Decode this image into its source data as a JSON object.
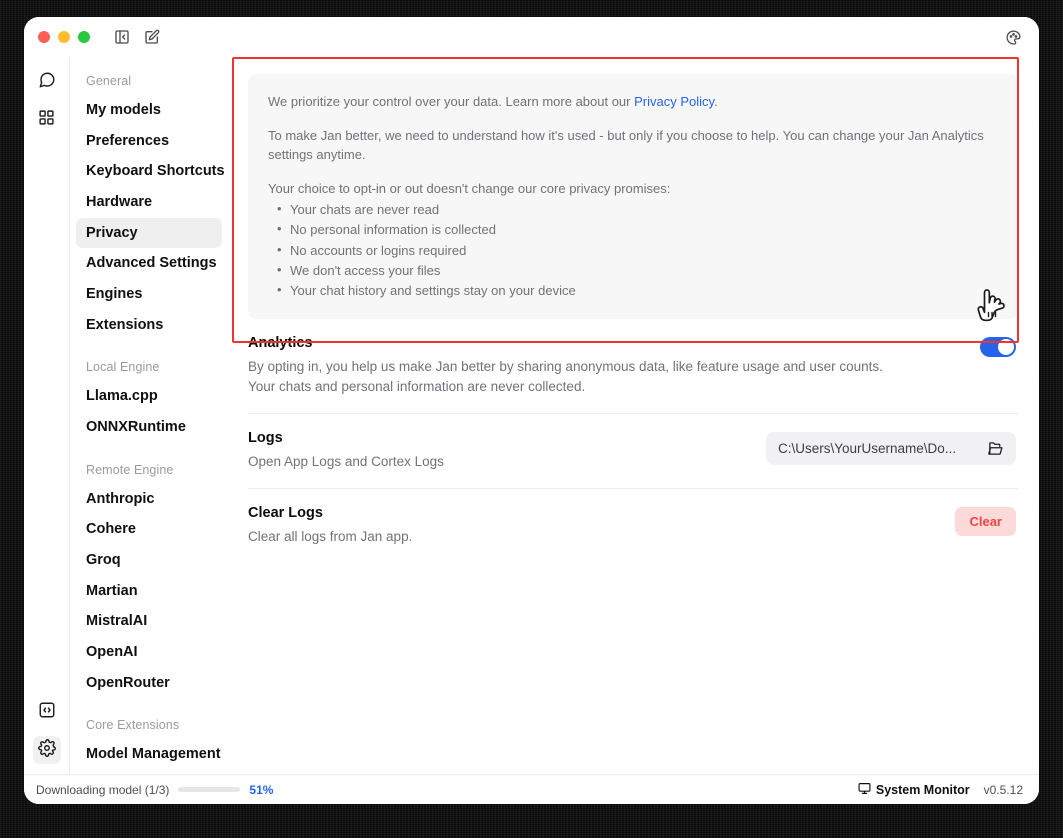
{
  "window": {
    "titlebar": {
      "traffic_lights": [
        "close",
        "minimize",
        "maximize"
      ],
      "toggle_sidebar_label": "Toggle sidebar",
      "new_chat_label": "New chat",
      "theme_label": "Appearance"
    }
  },
  "rail": {
    "items": [
      {
        "name": "chat",
        "icon": "chat-bubble-icon",
        "active": false
      },
      {
        "name": "hub",
        "icon": "grid-apps-icon",
        "active": false
      }
    ],
    "bottom_items": [
      {
        "name": "developer",
        "icon": "code-brackets-icon",
        "active": false
      },
      {
        "name": "settings",
        "icon": "gear-icon",
        "active": true
      }
    ]
  },
  "sidebar": {
    "groups": [
      {
        "label": "General",
        "items": [
          {
            "label": "My models",
            "selected": false
          },
          {
            "label": "Preferences",
            "selected": false
          },
          {
            "label": "Keyboard Shortcuts",
            "selected": false
          },
          {
            "label": "Hardware",
            "selected": false
          },
          {
            "label": "Privacy",
            "selected": true
          },
          {
            "label": "Advanced Settings",
            "selected": false
          },
          {
            "label": "Engines",
            "selected": false
          },
          {
            "label": "Extensions",
            "selected": false
          }
        ]
      },
      {
        "label": "Local Engine",
        "items": [
          {
            "label": "Llama.cpp",
            "selected": false
          },
          {
            "label": "ONNXRuntime",
            "selected": false
          }
        ]
      },
      {
        "label": "Remote Engine",
        "items": [
          {
            "label": "Anthropic",
            "selected": false
          },
          {
            "label": "Cohere",
            "selected": false
          },
          {
            "label": "Groq",
            "selected": false
          },
          {
            "label": "Martian",
            "selected": false
          },
          {
            "label": "MistralAI",
            "selected": false
          },
          {
            "label": "OpenAI",
            "selected": false
          },
          {
            "label": "OpenRouter",
            "selected": false
          }
        ]
      },
      {
        "label": "Core Extensions",
        "items": [
          {
            "label": "Model Management",
            "selected": false
          }
        ]
      }
    ]
  },
  "privacy_panel": {
    "paragraph_1_before_link": "We prioritize your control over your data. Learn more about our ",
    "link_text": "Privacy Policy",
    "paragraph_1_after_link": ".",
    "paragraph_2": "To make Jan better, we need to understand how it's used - but only if you choose to help. You can change your Jan Analytics settings anytime.",
    "promises_intro": "Your choice to opt-in or out doesn't change our core privacy promises:",
    "promises": [
      "Your chats are never read",
      "No personal information is collected",
      "No accounts or logins required",
      "We don't access your files",
      "Your chat history and settings stay on your device"
    ]
  },
  "settings": {
    "analytics": {
      "title": "Analytics",
      "description": "By opting in, you help us make Jan better by sharing anonymous data, like feature usage and user counts. Your chats and personal information are never collected.",
      "toggle_state": "on"
    },
    "logs": {
      "title": "Logs",
      "description": "Open App Logs and Cortex Logs",
      "path_value": "C:\\Users\\YourUsername\\Do...",
      "folder_icon": "folder-open-icon"
    },
    "clear_logs": {
      "title": "Clear Logs",
      "description": "Clear all logs from Jan app.",
      "button_label": "Clear"
    }
  },
  "statusbar": {
    "download_label": "Downloading model (1/3)",
    "progress_percent_label": "51%",
    "progress_fill_ratio": 30,
    "system_monitor_label": "System Monitor",
    "system_monitor_icon": "monitor-icon",
    "version": "v0.5.12"
  },
  "colors": {
    "accent_blue": "#2563eb",
    "annotation_red": "#f1322f",
    "clear_red": "#ef4444",
    "clear_bg": "#fcdada",
    "panel_bg": "#f7f7f8",
    "selected_nav_bg": "#efefef"
  }
}
